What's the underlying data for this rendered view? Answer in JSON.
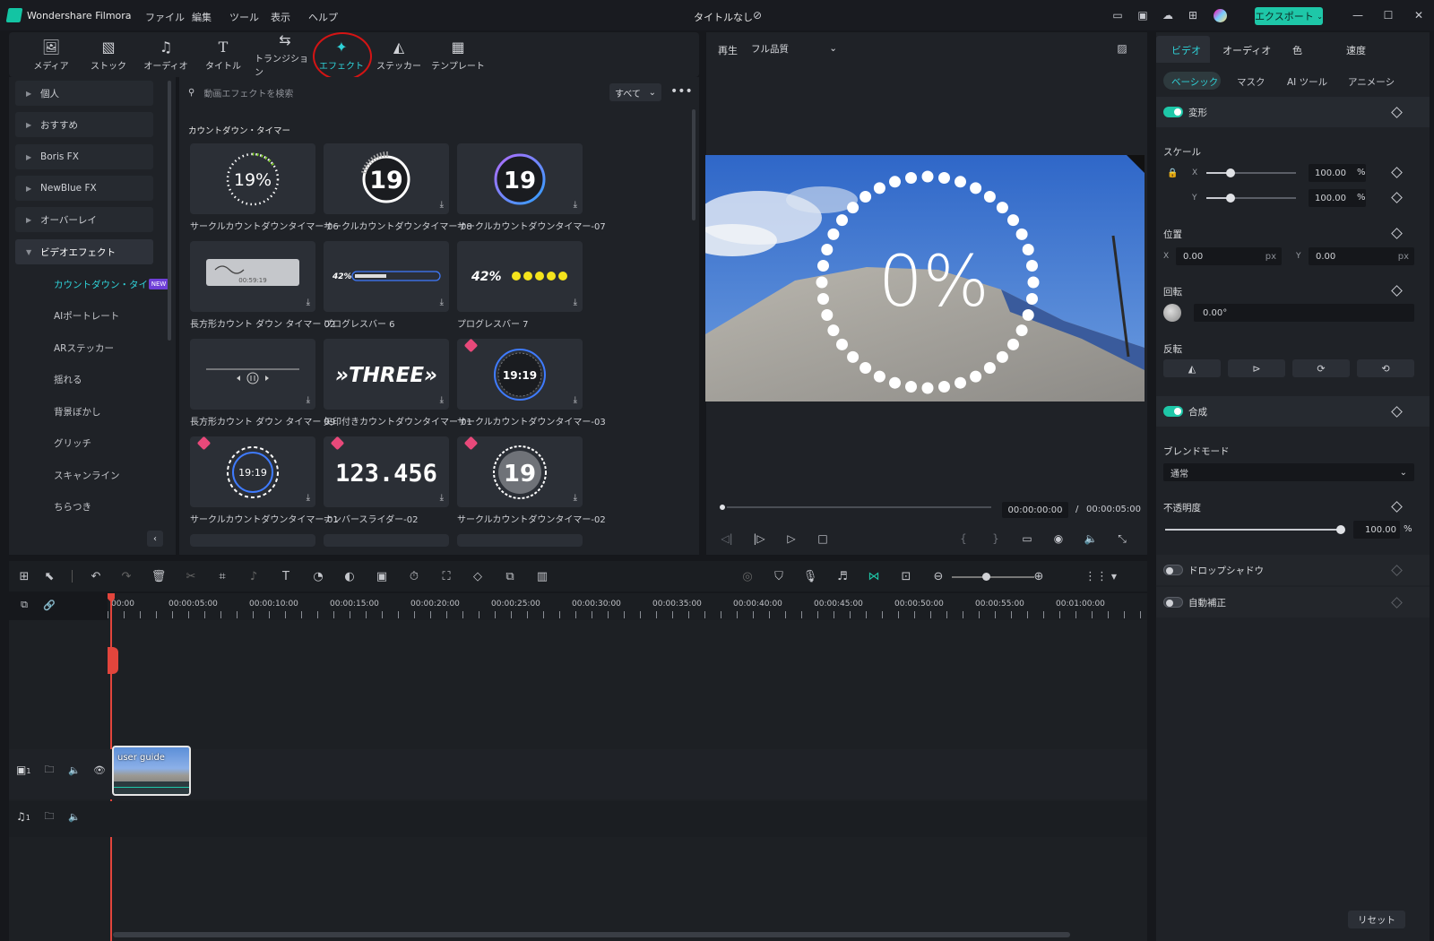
{
  "titlebar": {
    "app_name": "Wondershare Filmora",
    "menu": [
      "ファイル",
      "編集",
      "ツール",
      "表示",
      "ヘルプ"
    ],
    "document_title": "タイトルなし",
    "export_label": "エクスポート"
  },
  "media_toolbar": [
    {
      "label": "メディア",
      "icon": "media-icon"
    },
    {
      "label": "ストック",
      "icon": "stock-icon"
    },
    {
      "label": "オーディオ",
      "icon": "music-note-icon"
    },
    {
      "label": "タイトル",
      "icon": "title-t-icon"
    },
    {
      "label": "トランジション",
      "icon": "transition-icon"
    },
    {
      "label": "エフェクト",
      "icon": "effects-star-icon"
    },
    {
      "label": "ステッカー",
      "icon": "sticker-icon"
    },
    {
      "label": "テンプレート",
      "icon": "template-icon"
    }
  ],
  "categories": [
    {
      "label": "個人"
    },
    {
      "label": "おすすめ"
    },
    {
      "label": "Boris FX"
    },
    {
      "label": "NewBlue FX"
    },
    {
      "label": "オーバーレイ"
    },
    {
      "label": "ビデオエフェクト"
    }
  ],
  "subcategories": [
    {
      "label": "カウントダウン・タイマー",
      "active": true
    },
    {
      "label": "AIポートレート"
    },
    {
      "label": "ARステッカー"
    },
    {
      "label": "揺れる"
    },
    {
      "label": "背景ぼかし"
    },
    {
      "label": "グリッチ"
    },
    {
      "label": "スキャンライン"
    },
    {
      "label": "ちらつき"
    }
  ],
  "new_badge": "NEW",
  "search": {
    "placeholder": "動画エフェクトを検索",
    "filter": "すべて"
  },
  "section_title": "カウントダウン・タイマー",
  "effects": [
    {
      "label": "サークルカウントダウンタイマー-06",
      "thumb": "19%"
    },
    {
      "label": "サークルカウントダウンタイマー-08",
      "thumb": "19"
    },
    {
      "label": "サークルカウントダウンタイマー-07",
      "thumb": "19"
    },
    {
      "label": "長方形カウント ダウン タイマー 02",
      "thumb": "00:59:19"
    },
    {
      "label": "プログレスバー 6",
      "thumb": "42%"
    },
    {
      "label": "プログレスバー 7",
      "thumb": "42%"
    },
    {
      "label": "長方形カウント ダウン タイマー 09",
      "thumb": ""
    },
    {
      "label": "矢印付きカウントダウンタイマー 01",
      "thumb": "»THREE»"
    },
    {
      "label": "サークルカウントダウンタイマー-03",
      "thumb": "19:19"
    },
    {
      "label": "サークルカウントダウンタイマー-01",
      "thumb": "19:19"
    },
    {
      "label": "ナンバースライダー-02",
      "thumb": "123.456"
    },
    {
      "label": "サークルカウントダウンタイマー-02",
      "thumb": "19"
    }
  ],
  "preview": {
    "play_label": "再生",
    "quality": "フル品質",
    "overlay_text": "0%",
    "current_time": "00:00:00:00",
    "separator": "/",
    "total_time": "00:00:05:00"
  },
  "timeline": {
    "ruler": [
      "00:00",
      "00:00:05:00",
      "00:00:10:00",
      "00:00:15:00",
      "00:00:20:00",
      "00:00:25:00",
      "00:00:30:00",
      "00:00:35:00",
      "00:00:40:00",
      "00:00:45:00",
      "00:00:50:00",
      "00:00:55:00",
      "00:01:00:00"
    ],
    "clip_label": "user guide",
    "video_track_num": "1",
    "audio_track_num": "1"
  },
  "properties": {
    "tabs": [
      "ビデオ",
      "オーディオ",
      "色",
      "速度"
    ],
    "subtabs": [
      "ベーシック",
      "マスク",
      "AI ツール",
      "アニメーシ"
    ],
    "transform": "変形",
    "scale": "スケール",
    "scale_x_label": "X",
    "scale_y_label": "Y",
    "scale_x": "100.00",
    "scale_y": "100.00",
    "percent": "%",
    "position": "位置",
    "pos_x_label": "X",
    "pos_x": "0.00",
    "pos_y_label": "Y",
    "pos_y": "0.00",
    "px": "px",
    "rotation": "回転",
    "rotation_value": "0.00°",
    "flip": "反転",
    "composite": "合成",
    "blend_mode": "ブレンドモード",
    "blend_value": "通常",
    "opacity": "不透明度",
    "opacity_value": "100.00",
    "drop_shadow": "ドロップシャドウ",
    "auto_enhance": "自動補正",
    "reset": "リセット"
  }
}
